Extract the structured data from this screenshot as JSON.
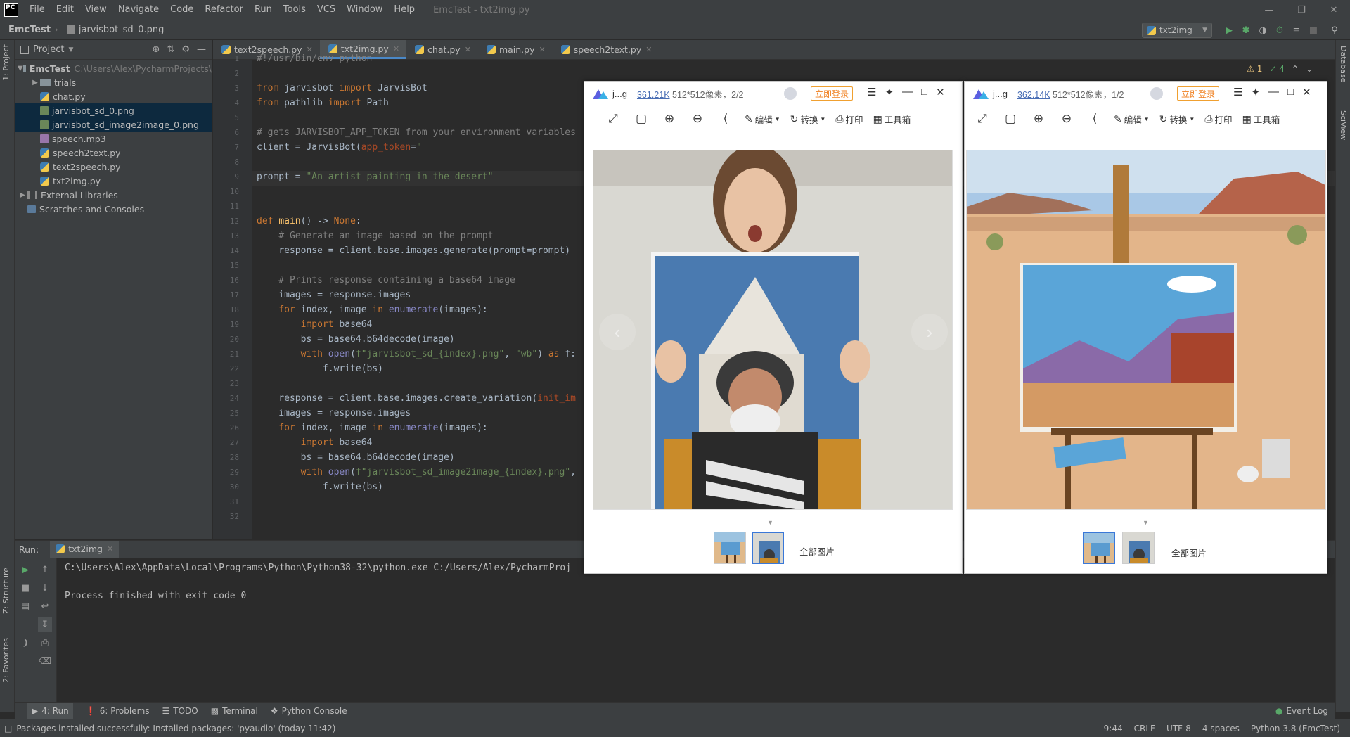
{
  "menubar": {
    "items": [
      "File",
      "Edit",
      "View",
      "Navigate",
      "Code",
      "Refactor",
      "Run",
      "Tools",
      "VCS",
      "Window",
      "Help"
    ],
    "window_title": "EmcTest - txt2img.py",
    "logo": "PC"
  },
  "navbar": {
    "project": "EmcTest",
    "file": "jarvisbot_sd_0.png",
    "run_config": "txt2img"
  },
  "stripes": {
    "left_top": "1: Project",
    "left_mid": "Z: Structure",
    "left_bottom": "2: Favorites",
    "right_top": "Database",
    "right_mid": "SciView"
  },
  "project_panel": {
    "title": "Project",
    "root_name": "EmcTest",
    "root_path": "C:\\Users\\Alex\\PycharmProjects\\",
    "items": [
      {
        "label": "trials",
        "type": "folder"
      },
      {
        "label": "chat.py",
        "type": "py"
      },
      {
        "label": "jarvisbot_sd_0.png",
        "type": "img",
        "selected": true
      },
      {
        "label": "jarvisbot_sd_image2image_0.png",
        "type": "img",
        "selected": true
      },
      {
        "label": "speech.mp3",
        "type": "mp3"
      },
      {
        "label": "speech2text.py",
        "type": "py"
      },
      {
        "label": "text2speech.py",
        "type": "py"
      },
      {
        "label": "txt2img.py",
        "type": "py"
      }
    ],
    "external_libraries": "External Libraries",
    "scratches": "Scratches and Consoles"
  },
  "tabs": [
    {
      "label": "text2speech.py",
      "active": false
    },
    {
      "label": "txt2img.py",
      "active": true
    },
    {
      "label": "chat.py",
      "active": false
    },
    {
      "label": "main.py",
      "active": false
    },
    {
      "label": "speech2text.py",
      "active": false
    }
  ],
  "editor": {
    "warnings": "1",
    "checks": "4",
    "lines": [
      {
        "n": "1",
        "text": "#!/usr/bin/env python"
      },
      {
        "n": "2",
        "text": ""
      },
      {
        "n": "3",
        "text": "from jarvisbot import JarvisBot"
      },
      {
        "n": "4",
        "text": "from pathlib import Path"
      },
      {
        "n": "5",
        "text": ""
      },
      {
        "n": "6",
        "text": "# gets JARVISBOT_APP_TOKEN from your environment variables"
      },
      {
        "n": "7",
        "text": "client = JarvisBot(app_token=\""
      },
      {
        "n": "8",
        "text": ""
      },
      {
        "n": "9",
        "text": "prompt = \"An artist painting in the desert\""
      },
      {
        "n": "10",
        "text": ""
      },
      {
        "n": "11",
        "text": ""
      },
      {
        "n": "12",
        "text": "def main() -> None:"
      },
      {
        "n": "13",
        "text": "    # Generate an image based on the prompt"
      },
      {
        "n": "14",
        "text": "    response = client.base.images.generate(prompt=prompt)"
      },
      {
        "n": "15",
        "text": ""
      },
      {
        "n": "16",
        "text": "    # Prints response containing a base64 image"
      },
      {
        "n": "17",
        "text": "    images = response.images"
      },
      {
        "n": "18",
        "text": "    for index, image in enumerate(images):"
      },
      {
        "n": "19",
        "text": "        import base64"
      },
      {
        "n": "20",
        "text": "        bs = base64.b64decode(image)"
      },
      {
        "n": "21",
        "text": "        with open(f\"jarvisbot_sd_{index}.png\", \"wb\") as f:"
      },
      {
        "n": "22",
        "text": "            f.write(bs)"
      },
      {
        "n": "23",
        "text": ""
      },
      {
        "n": "24",
        "text": "    response = client.base.images.create_variation(init_im"
      },
      {
        "n": "25",
        "text": "    images = response.images"
      },
      {
        "n": "26",
        "text": "    for index, image in enumerate(images):"
      },
      {
        "n": "27",
        "text": "        import base64"
      },
      {
        "n": "28",
        "text": "        bs = base64.b64decode(image)"
      },
      {
        "n": "29",
        "text": "        with open(f\"jarvisbot_sd_image2image_{index}.png\","
      },
      {
        "n": "30",
        "text": "            f.write(bs)"
      },
      {
        "n": "31",
        "text": ""
      },
      {
        "n": "32",
        "text": ""
      }
    ]
  },
  "run_panel": {
    "label": "Run:",
    "tab": "txt2img",
    "command": "C:\\Users\\Alex\\AppData\\Local\\Programs\\Python\\Python38-32\\python.exe C:/Users/Alex/PycharmProj",
    "result": "Process finished with exit code 0"
  },
  "bottom_tools": {
    "run": "4: Run",
    "problems": "6: Problems",
    "todo": "TODO",
    "terminal": "Terminal",
    "python_console": "Python Console",
    "event_log": "Event Log"
  },
  "status_bar": {
    "message": "Packages installed successfully: Installed packages: 'pyaudio' (today 11:42)",
    "position": "9:44",
    "line_sep": "CRLF",
    "encoding": "UTF-8",
    "indent": "4 spaces",
    "interpreter": "Python 3.8 (EmcTest)"
  },
  "viewer_left": {
    "name": "j...g",
    "size": "361.21K",
    "dims": "512*512像素",
    "index": "2/2",
    "login": "立即登录",
    "edit": "编辑",
    "convert": "转换",
    "print": "打印",
    "tools": "工具箱",
    "all_pics": "全部图片"
  },
  "viewer_right": {
    "name": "j...g",
    "size": "362.14K",
    "dims": "512*512像素",
    "index": "1/2",
    "login": "立即登录",
    "edit": "编辑",
    "convert": "转换",
    "print": "打印",
    "tools": "工具箱",
    "all_pics": "全部图片"
  },
  "colors": {
    "accent": "#4a88c7",
    "keyword": "#cc7832",
    "string": "#6a8759",
    "comment": "#808080",
    "function": "#ffc66d"
  }
}
